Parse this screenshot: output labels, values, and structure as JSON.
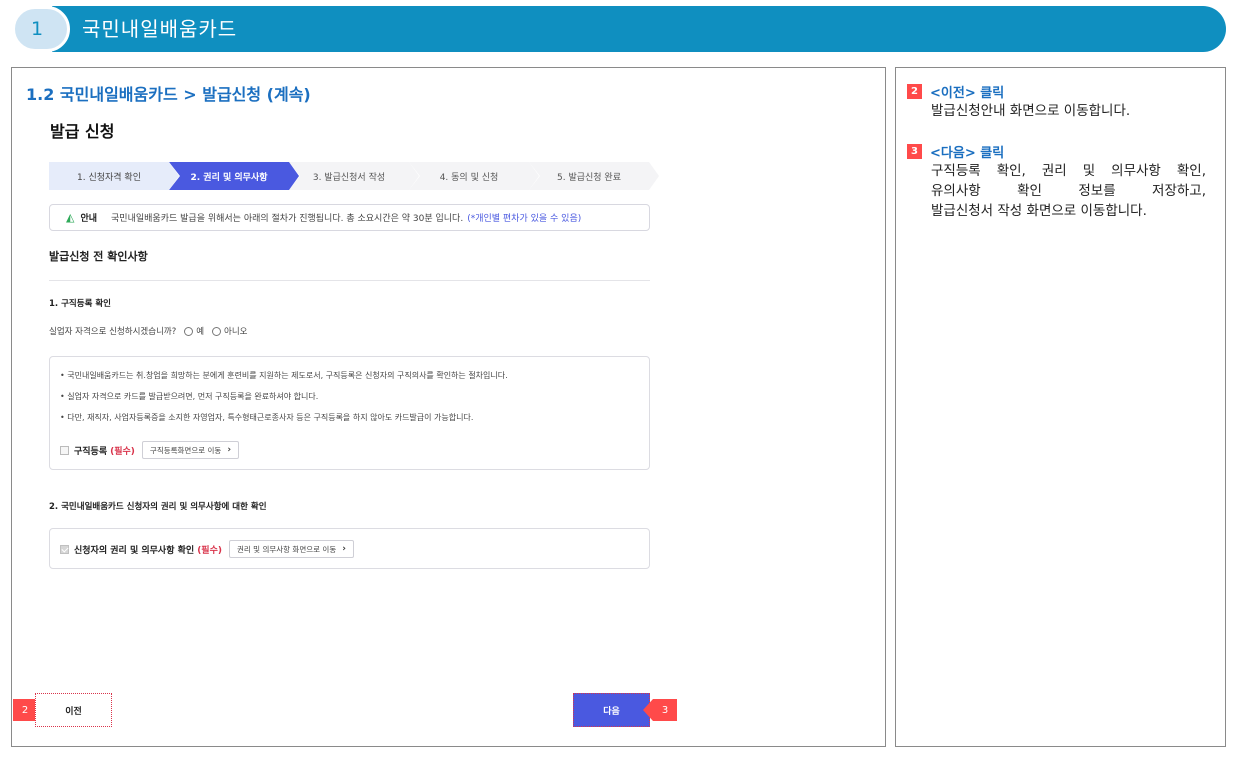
{
  "banner": {
    "number": "1",
    "title": "국민내일배움카드"
  },
  "left": {
    "section_heading": "1.2 국민내일배움카드 > 발급신청 (계속)",
    "page_title": "발급 신청",
    "steps": [
      {
        "label": "1. 신청자격 확인"
      },
      {
        "label": "2. 권리 및 의무사항"
      },
      {
        "label": "3. 발급신청서 작성"
      },
      {
        "label": "4. 동의 및 신청"
      },
      {
        "label": "5. 발급신청 완료"
      }
    ],
    "notice": {
      "label": "안내",
      "message": "국민내일배움카드 발급을 위해서는 아래의 절차가 진행됩니다. 총 소요시간은 약 30분 입니다.",
      "hint": "(*개인별 편차가 있을 수 있음)"
    },
    "sub_heading": "발급신청 전 확인사항",
    "q1": {
      "title": "1. 구직등록 확인",
      "question": "실업자 자격으로 신청하시겠습니까?",
      "option_yes": "예",
      "option_no": "아니오",
      "bullets": [
        "• 국민내일배움카드는 취.창업을 희망하는 분에게 훈련비를 지원하는 제도로서, 구직등록은 신청자의 구직의사를 확인하는 절차입니다.",
        "• 실업자 자격으로 카드를 발급받으려면, 먼저 구직등록을 완료하셔야 합니다.",
        "• 다만, 재직자, 사업자등록증을 소지한 자영업자, 특수형태근로종사자 등은 구직등록을 하지 않아도 카드발급이 가능합니다."
      ],
      "check_label": "구직등록",
      "required": "(필수)",
      "link_button": "구직등록화면으로 이동"
    },
    "q2": {
      "title": "2. 국민내일배움카드 신청자의 권리 및 의무사항에 대한 확인",
      "check_label": "신청자의 권리 및 의무사항 확인",
      "required": "(필수)",
      "link_button": "권리 및 의무사항 화면으로 이동"
    },
    "prev_button": "이전",
    "next_button": "다음",
    "marker_prev": "2",
    "marker_next": "3"
  },
  "right": {
    "notes": [
      {
        "badge": "2",
        "title": "<이전> 클릭",
        "lines": [
          "발급신청안내 화면으로 이동합니다."
        ]
      },
      {
        "badge": "3",
        "title": "<다음> 클릭",
        "lines": [
          "구직등록 확인, 권리 및 의무사항 확인,",
          "유의사항 확인 정보를 저장하고,",
          "발급신청서 작성 화면으로 이동합니다."
        ]
      }
    ]
  },
  "colors": {
    "accent": "#0f8fc0",
    "primary_button": "#4a59e0",
    "marker": "#ff4a4a",
    "heading_blue": "#1b6fc0",
    "required_red": "#d9344b"
  }
}
